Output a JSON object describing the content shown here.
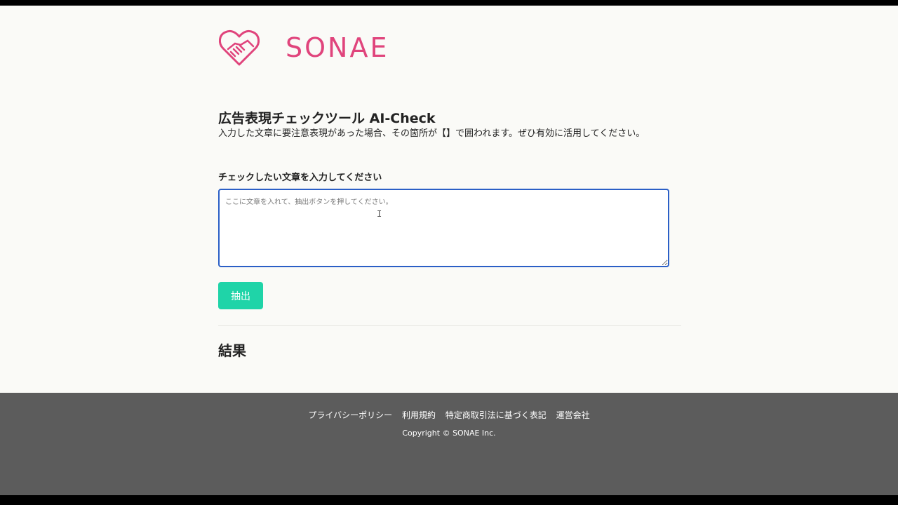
{
  "brand": {
    "name": "SONAE",
    "color": "#e0447c"
  },
  "main": {
    "title": "広告表現チェックツール AI-Check",
    "description": "入力した文章に要注意表現があった場合、その箇所が【】で囲われます。ぜひ有効に活用してください。",
    "field_label": "チェックしたい文章を入力してください",
    "textarea_placeholder": "ここに文章を入れて、抽出ボタンを押してください。",
    "submit_label": "抽出",
    "result_heading": "結果"
  },
  "footer": {
    "links": [
      "プライバシーポリシー",
      "利用規約",
      "特定商取引法に基づく表記",
      "運営会社"
    ],
    "copyright": "Copyright © SONAE Inc."
  },
  "colors": {
    "accent_button": "#1fd4a8",
    "focus_border": "#2b5fc6",
    "footer_bg": "#5c5c5c"
  }
}
